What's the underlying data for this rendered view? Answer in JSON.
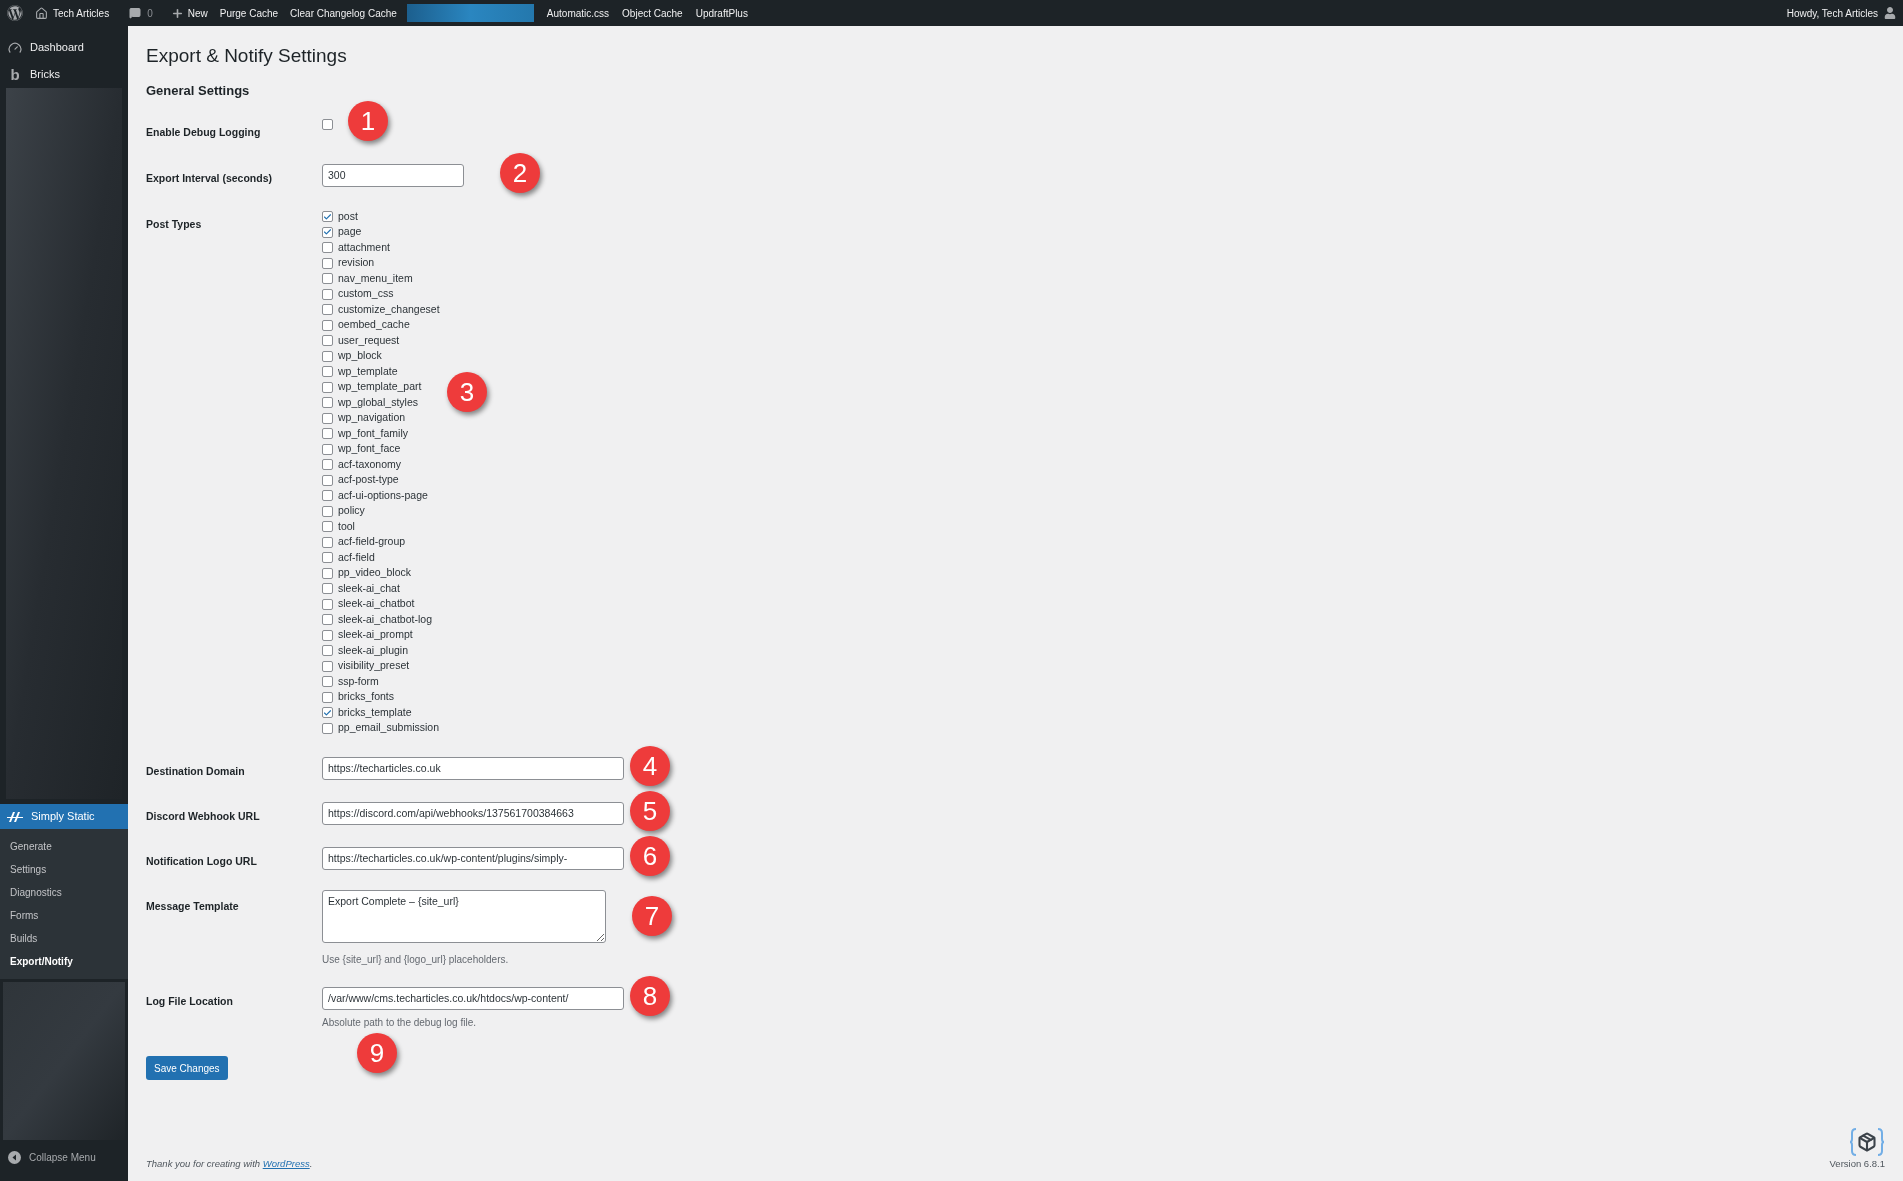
{
  "admin_bar": {
    "site_name": "Tech Articles",
    "comments_count": "0",
    "new_label": "New",
    "items": [
      "Purge Cache",
      "Clear Changelog Cache"
    ],
    "items_after": [
      "Automatic.css",
      "Object Cache",
      "UpdraftPlus"
    ],
    "greeting": "Howdy, Tech Articles"
  },
  "sidebar": {
    "items": [
      {
        "label": "Dashboard",
        "kind": "dashboard"
      },
      {
        "label": "Bricks",
        "kind": "bricks",
        "glyph": "b"
      }
    ],
    "active_menu": {
      "label": "Simply Static",
      "submenu": [
        {
          "label": "Generate",
          "selected": false
        },
        {
          "label": "Settings",
          "selected": false
        },
        {
          "label": "Diagnostics",
          "selected": false
        },
        {
          "label": "Forms",
          "selected": false
        },
        {
          "label": "Builds",
          "selected": false
        },
        {
          "label": "Export/Notify",
          "selected": true
        }
      ]
    },
    "collapse_label": "Collapse Menu"
  },
  "page": {
    "title": "Export & Notify Settings",
    "section_title": "General Settings",
    "fields": [
      {
        "kind": "checkbox",
        "label": "Enable Debug Logging",
        "checked": false,
        "marker": "1"
      },
      {
        "kind": "number",
        "label": "Export Interval (seconds)",
        "value": "300",
        "marker": "2"
      },
      {
        "kind": "checklist",
        "label": "Post Types",
        "marker": "3",
        "options": [
          {
            "label": "post",
            "checked": true
          },
          {
            "label": "page",
            "checked": true
          },
          {
            "label": "attachment",
            "checked": false
          },
          {
            "label": "revision",
            "checked": false
          },
          {
            "label": "nav_menu_item",
            "checked": false
          },
          {
            "label": "custom_css",
            "checked": false
          },
          {
            "label": "customize_changeset",
            "checked": false
          },
          {
            "label": "oembed_cache",
            "checked": false
          },
          {
            "label": "user_request",
            "checked": false
          },
          {
            "label": "wp_block",
            "checked": false
          },
          {
            "label": "wp_template",
            "checked": false
          },
          {
            "label": "wp_template_part",
            "checked": false
          },
          {
            "label": "wp_global_styles",
            "checked": false
          },
          {
            "label": "wp_navigation",
            "checked": false
          },
          {
            "label": "wp_font_family",
            "checked": false
          },
          {
            "label": "wp_font_face",
            "checked": false
          },
          {
            "label": "acf-taxonomy",
            "checked": false
          },
          {
            "label": "acf-post-type",
            "checked": false
          },
          {
            "label": "acf-ui-options-page",
            "checked": false
          },
          {
            "label": "policy",
            "checked": false
          },
          {
            "label": "tool",
            "checked": false
          },
          {
            "label": "acf-field-group",
            "checked": false
          },
          {
            "label": "acf-field",
            "checked": false
          },
          {
            "label": "pp_video_block",
            "checked": false
          },
          {
            "label": "sleek-ai_chat",
            "checked": false
          },
          {
            "label": "sleek-ai_chatbot",
            "checked": false
          },
          {
            "label": "sleek-ai_chatbot-log",
            "checked": false
          },
          {
            "label": "sleek-ai_prompt",
            "checked": false
          },
          {
            "label": "sleek-ai_plugin",
            "checked": false
          },
          {
            "label": "visibility_preset",
            "checked": false
          },
          {
            "label": "ssp-form",
            "checked": false
          },
          {
            "label": "bricks_fonts",
            "checked": false
          },
          {
            "label": "bricks_template",
            "checked": true
          },
          {
            "label": "pp_email_submission",
            "checked": false
          }
        ]
      },
      {
        "kind": "text",
        "label": "Destination Domain",
        "value": "https://techarticles.co.uk",
        "marker": "4"
      },
      {
        "kind": "text",
        "label": "Discord Webhook URL",
        "value": "https://discord.com/api/webhooks/137561700384663",
        "marker": "5"
      },
      {
        "kind": "text",
        "label": "Notification Logo URL",
        "value": "https://techarticles.co.uk/wp-content/plugins/simply-",
        "marker": "6"
      },
      {
        "kind": "textarea",
        "label": "Message Template",
        "value": "Export Complete – {site_url}",
        "help": "Use {site_url} and {logo_url} placeholders.",
        "marker": "7"
      },
      {
        "kind": "text",
        "label": "Log File Location",
        "value": "/var/www/cms.techarticles.co.uk/htdocs/wp-content/",
        "help": "Absolute path to the debug log file.",
        "marker": "8",
        "below_marker": "9"
      }
    ],
    "save_label": "Save Changes"
  },
  "footer": {
    "prefix": "Thank you for creating with ",
    "link": "WordPress",
    "suffix": "."
  },
  "version": "Version 6.8.1"
}
